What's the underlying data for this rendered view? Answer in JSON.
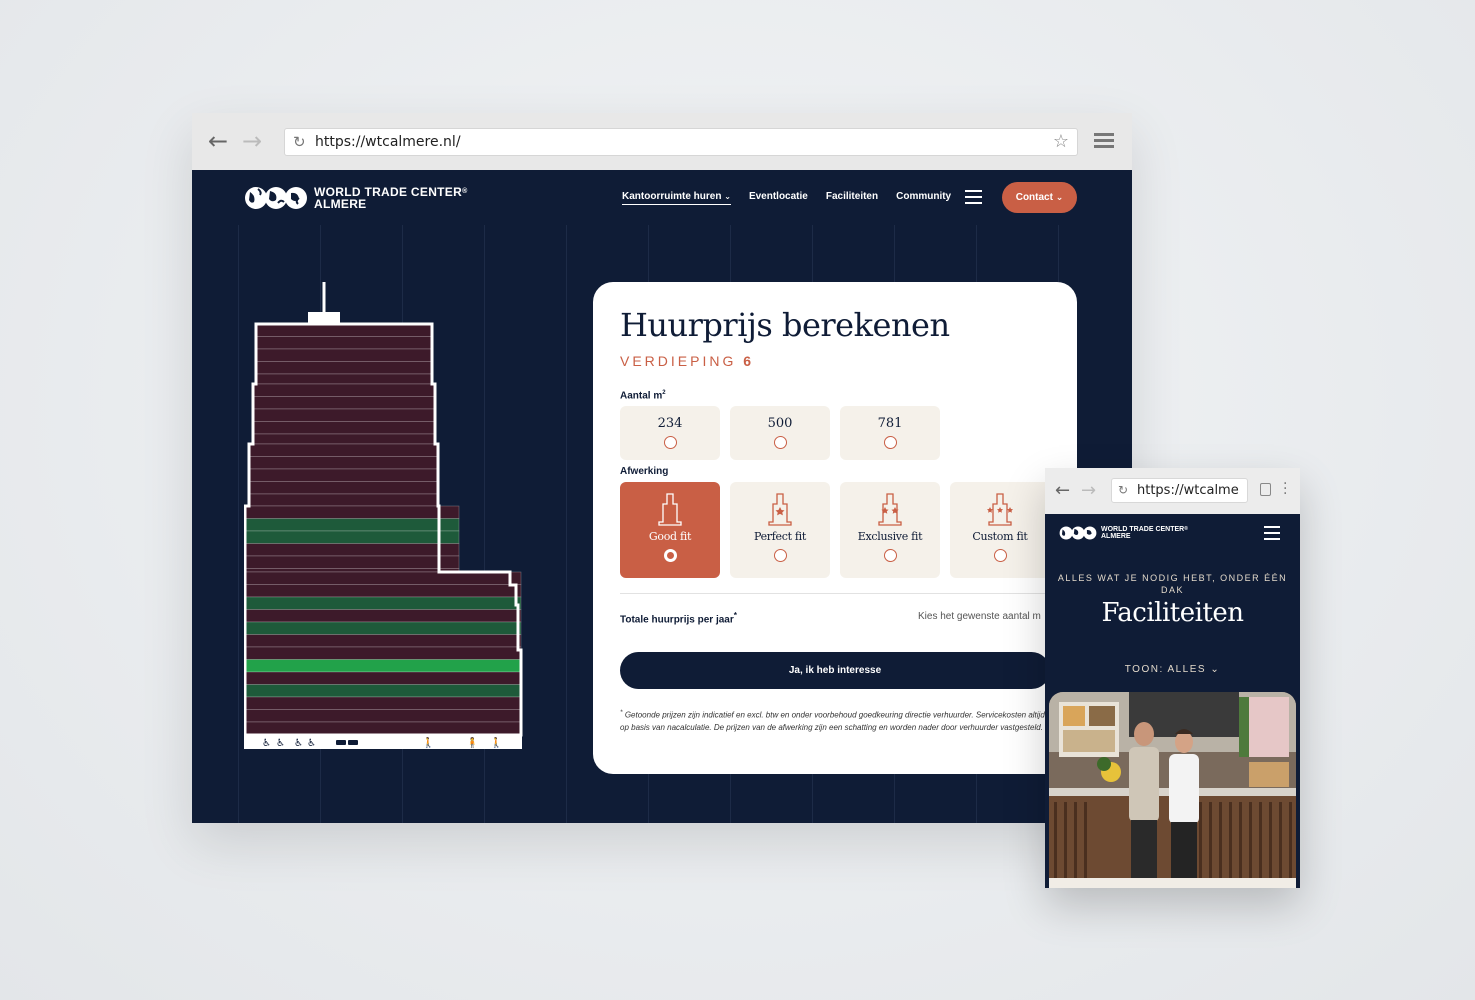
{
  "desktop": {
    "url": "https://wtcalmere.nl/",
    "logo": {
      "line1": "WORLD TRADE CENTER",
      "reg": "®",
      "line2": "ALMERE"
    },
    "nav": [
      {
        "label": "Kantoorruimte huren"
      },
      {
        "label": "Eventlocatie"
      },
      {
        "label": "Faciliteiten"
      },
      {
        "label": "Community"
      }
    ],
    "contact_label": "Contact",
    "calculator": {
      "title": "Huurprijs berekenen",
      "floor_prefix": "VERDIEPING",
      "floor_number": "6",
      "area_label": "Aantal m",
      "area_sup": "2",
      "area_options": [
        "234",
        "500",
        "781"
      ],
      "finish_label": "Afwerking",
      "finish_options": [
        "Good fit",
        "Perfect fit",
        "Exclusive fit",
        "Custom fit"
      ],
      "selected_finish": "Good fit",
      "total_label": "Totale huurprijs per jaar",
      "total_sup": "*",
      "total_hint": "Kies het gewenste aantal m",
      "cta": "Ja, ik heb interesse",
      "disclaimer_star": "*",
      "disclaimer": "Getoonde prijzen zijn indicatief en excl. btw en onder voorbehoud goedkeuring directie verhuurder. Servicekosten altijd op basis van nacalculatie. De prijzen van de afwerking zijn een schatting en worden nader door verhuurder vastgesteld."
    },
    "colors": {
      "navy": "#0f1c36",
      "accent": "#c95f45",
      "floor": "#3d1a2a",
      "floor_available": "#1e5a3a",
      "floor_highlight": "#22a24a"
    }
  },
  "mobile": {
    "url": "https://wtcalme",
    "logo": {
      "line1": "WORLD TRADE CENTER",
      "reg": "®",
      "line2": "ALMERE"
    },
    "kicker": "ALLES WAT JE NODIG HEBT, ONDER ÉÉN DAK",
    "title": "Faciliteiten",
    "filter": "TOON: ALLES"
  }
}
